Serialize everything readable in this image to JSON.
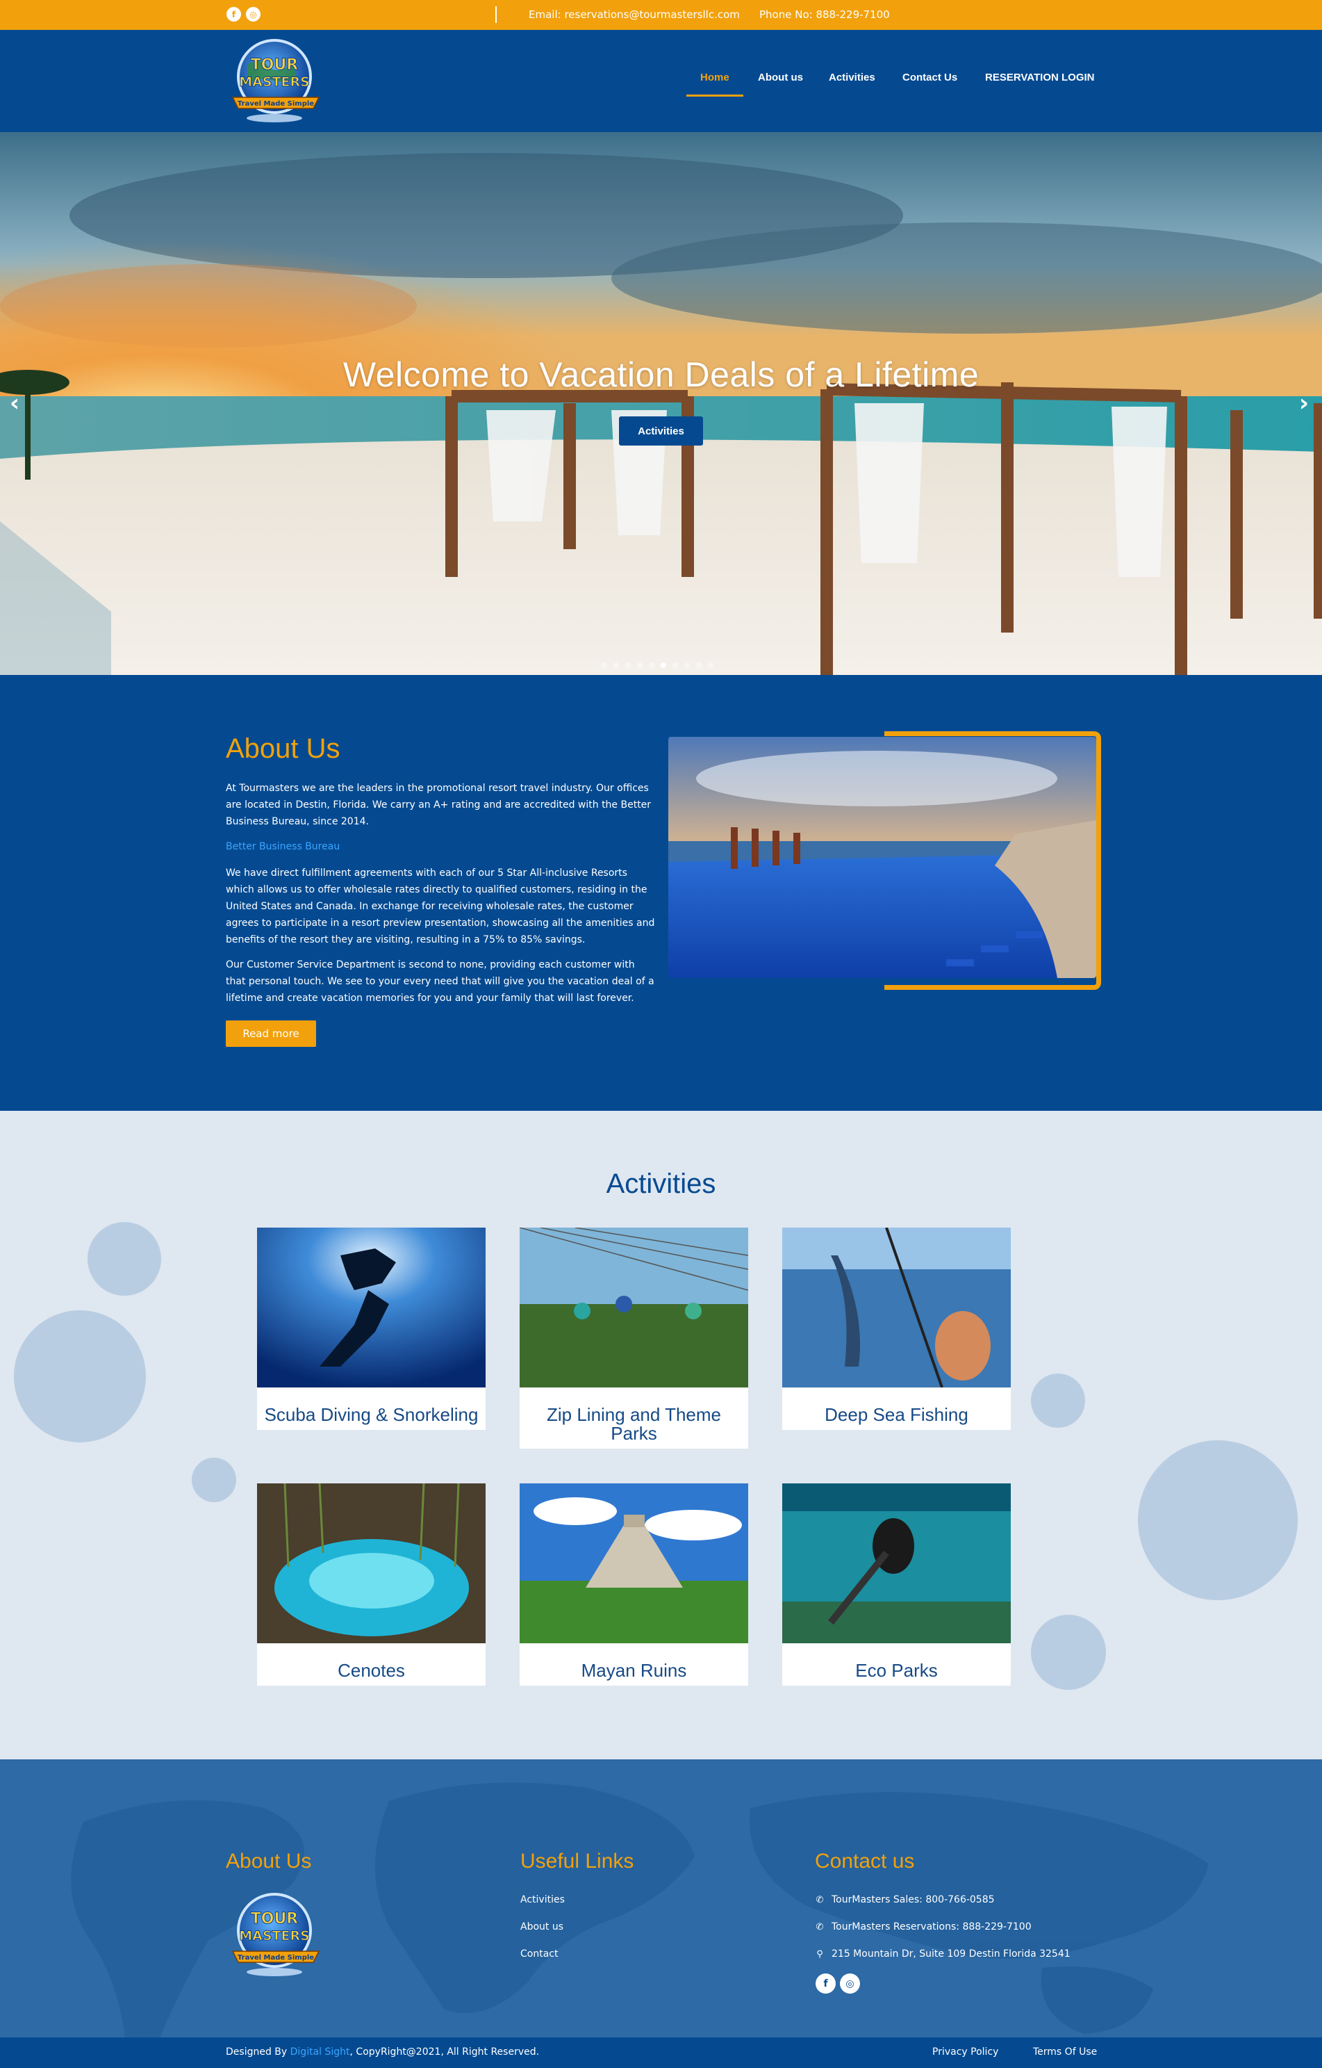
{
  "topbar": {
    "facebook_icon": "f",
    "instagram_icon": "◎",
    "email": "Email: reservations@tourmastersllc.com",
    "phone": "Phone No: 888-229-7100"
  },
  "brand": {
    "logo_line1": "TOUR",
    "logo_line2": "MASTERS",
    "logo_ribbon": "Travel Made Simple"
  },
  "nav": {
    "items": [
      "Home",
      "About us",
      "Activities",
      "Contact Us",
      "RESERVATION LOGIN"
    ],
    "active": "Home"
  },
  "hero": {
    "title": "Welcome to Vacation Deals of a Lifetime",
    "button": "Activities",
    "prev_arrow": "‹",
    "next_arrow": "›",
    "slide_count": 10,
    "active_slide": 5
  },
  "about": {
    "title": "About Us",
    "p1": "At Tourmasters we are the leaders in the promotional resort travel industry. Our offices are located in Destin, Florida. We carry an A+ rating and are accredited with the Better Business Bureau, since 2014.",
    "bbb_link": "Better Business Bureau",
    "p2": "We have direct fulfillment agreements with each of our 5 Star All-inclusive Resorts which allows us to offer wholesale rates directly to qualified customers, residing in the United States and Canada. In exchange for receiving wholesale rates, the customer agrees to participate in a resort preview presentation, showcasing all the amenities and benefits of the resort they are visiting, resulting in a 75% to 85% savings.",
    "p3": "Our Customer Service Department is second to none, providing each customer with that personal touch.  We see to your every need that will give you the vacation deal of a lifetime and create vacation memories for you and your family that will last forever.",
    "read_more": "Read more"
  },
  "activities": {
    "title": "Activities",
    "cards": [
      {
        "label": "Scuba Diving & Snorkeling"
      },
      {
        "label": "Zip Lining and Theme Parks"
      },
      {
        "label": "Deep Sea Fishing"
      },
      {
        "label": "Cenotes"
      },
      {
        "label": "Mayan Ruins"
      },
      {
        "label": "Eco Parks"
      }
    ]
  },
  "footer": {
    "about_title": "About Us",
    "links_title": "Useful Links",
    "links": [
      "Activities",
      "About us",
      "Contact"
    ],
    "contact_title": "Contact us",
    "sales": "TourMasters Sales: 800-766-0585",
    "reservations": "TourMasters Reservations: 888-229-7100",
    "address": "215 Mountain Dr, Suite 109 Destin Florida 32541",
    "phone_icon": "✆",
    "pin_icon": "⚲",
    "facebook_icon": "f",
    "instagram_icon": "◎"
  },
  "bottom": {
    "designed_by": "Designed By",
    "designer": "Digital Sight",
    "copyright": ",    CopyRight@2021,  All Right Reserved.",
    "privacy": "Privacy Policy",
    "terms": "Terms Of Use"
  },
  "colors": {
    "brand_orange": "#f2a10c",
    "brand_blue": "#054a91",
    "activities_bg": "#dfe7f0",
    "footer_blue": "#2d6aa6"
  }
}
